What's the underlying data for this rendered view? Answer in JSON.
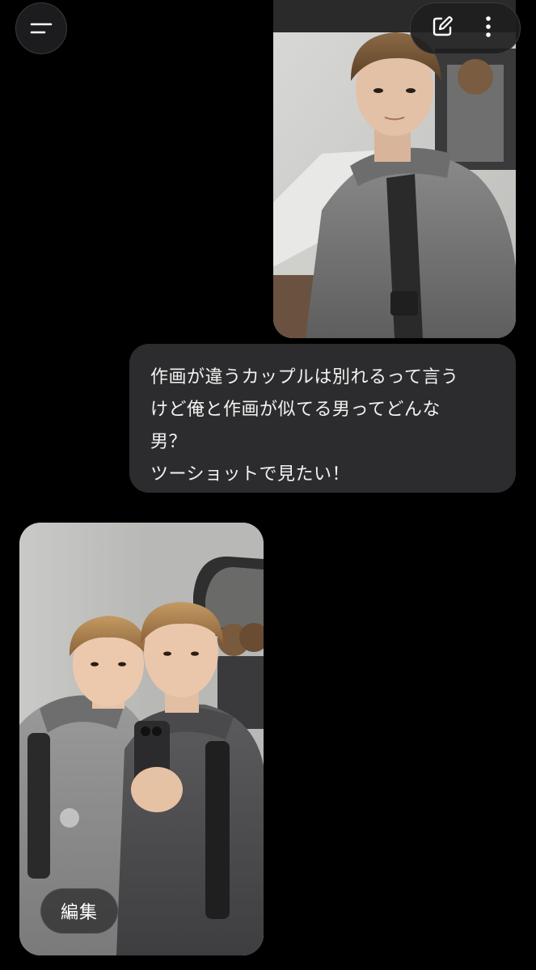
{
  "header": {
    "menu_icon": "menu-lines-icon",
    "actions": [
      {
        "icon": "edit-icon"
      },
      {
        "icon": "more-vertical-icon"
      }
    ]
  },
  "conversation": {
    "user_photo": {
      "description_icon": "selfie-photo"
    },
    "user_message": {
      "lines": [
        "作画が違うカップルは別れるって言う",
        "けど俺と作画が似てる男ってどんな",
        "男？",
        "ツーショットで見たい！"
      ]
    },
    "generated_image": {
      "edit_label": "編集"
    }
  },
  "colors": {
    "background": "#000000",
    "bubble": "#2c2c2e",
    "text": "#f2f2f2"
  }
}
